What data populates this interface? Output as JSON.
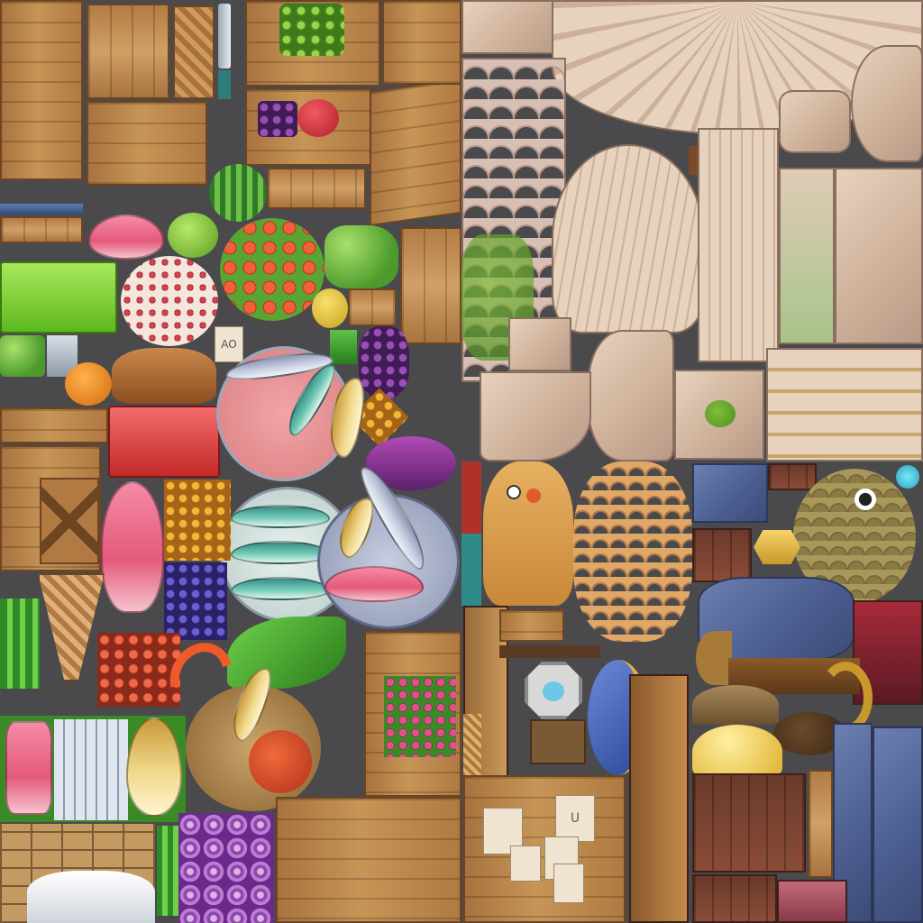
{
  "image": {
    "description_labels": {
      "market_quadrant": "market-props",
      "statue_quadrant": "statue-stone",
      "nature_quadrant": "owl-and-woodwork",
      "blue_quadrant": "blue-stone-and-bird"
    }
  },
  "market": {
    "sign_text": "AO"
  },
  "board": {
    "notice_letter": "U"
  },
  "colors": {
    "background": "#4a4a4c",
    "wood": "#c79556",
    "stone": "#e7d2bd",
    "blue_stone": "#4b5d8f",
    "moss": "#7fbf3a",
    "fish_pink": "#e45a7a",
    "fish_teal": "#6fcab6",
    "paw_blue": "#6fc7e6"
  }
}
